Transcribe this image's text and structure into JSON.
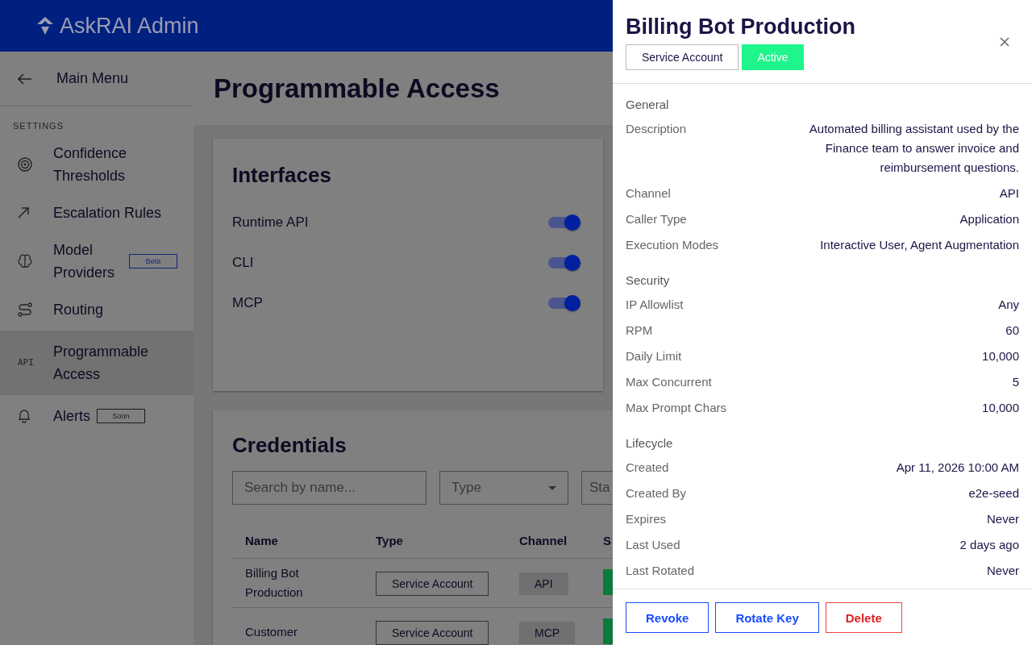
{
  "app": {
    "title": "AskRAI Admin"
  },
  "sidebar": {
    "back": "Main Menu",
    "section": "SETTINGS",
    "items": [
      {
        "label": "Confidence Thresholds",
        "kind": "target",
        "selected": false
      },
      {
        "label": "Escalation Rules",
        "kind": "arrow",
        "selected": false
      },
      {
        "label": "Model Providers",
        "kind": "brain",
        "selected": false,
        "badge": {
          "text": "Beta",
          "color": "#0d2680"
        }
      },
      {
        "label": "Routing",
        "kind": "route",
        "selected": false
      },
      {
        "label": "Programmable Access",
        "kind": "text",
        "icon_text": "API",
        "selected": true
      },
      {
        "label": "Alerts",
        "kind": "bell",
        "selected": false,
        "badge": {
          "text": "Soon",
          "color": "#1a1a1a"
        }
      }
    ]
  },
  "page": {
    "title": "Programmable Access"
  },
  "interfaces": {
    "title": "Interfaces",
    "items": [
      {
        "label": "Runtime API",
        "on": true
      },
      {
        "label": "CLI",
        "on": true
      },
      {
        "label": "MCP",
        "on": true
      }
    ]
  },
  "credentials": {
    "title": "Credentials",
    "search": {
      "placeholder": "Search by name..."
    },
    "filters": [
      {
        "placeholder": "Type",
        "kind": "select"
      },
      {
        "placeholder": "Sta",
        "kind": "cut"
      }
    ],
    "columns": [
      "Name",
      "Type",
      "Channel",
      "S"
    ],
    "rows": [
      {
        "name": "Billing Bot Production",
        "type": "Service Account",
        "channel": "API",
        "color": "#0b7a3c"
      },
      {
        "name": "Customer",
        "type": "Service Account",
        "channel": "MCP",
        "color": "#0b7a3c"
      }
    ]
  },
  "drawer": {
    "title": "Billing Bot Production",
    "chips": [
      {
        "text": "Service Account",
        "kind": "outline"
      },
      {
        "text": "Active",
        "kind": "status"
      }
    ],
    "sections": [
      {
        "title": "General",
        "fields": [
          {
            "label": "Description",
            "value": "Automated billing assistant used by the Finance team to answer invoice and reimbursement questions."
          },
          {
            "label": "Channel",
            "value": "API"
          },
          {
            "label": "Caller Type",
            "value": "Application"
          },
          {
            "label": "Execution Modes",
            "value": "Interactive User, Agent Augmentation"
          }
        ]
      },
      {
        "title": "Security",
        "fields": [
          {
            "label": "IP Allowlist",
            "value": "Any"
          },
          {
            "label": "RPM",
            "value": "60"
          },
          {
            "label": "Daily Limit",
            "value": "10,000"
          },
          {
            "label": "Max Concurrent",
            "value": "5"
          },
          {
            "label": "Max Prompt Chars",
            "value": "10,000"
          }
        ]
      },
      {
        "title": "Lifecycle",
        "fields": [
          {
            "label": "Created",
            "value": "Apr 11, 2026 10:00 AM"
          },
          {
            "label": "Created By",
            "value": "e2e-seed"
          },
          {
            "label": "Expires",
            "value": "Never"
          },
          {
            "label": "Last Used",
            "value": "2 days ago"
          },
          {
            "label": "Last Rotated",
            "value": "Never"
          }
        ]
      }
    ],
    "actions": [
      {
        "label": "Revoke",
        "kind": "primary"
      },
      {
        "label": "Rotate Key",
        "kind": "primary"
      },
      {
        "label": "Delete",
        "kind": "danger"
      }
    ]
  }
}
